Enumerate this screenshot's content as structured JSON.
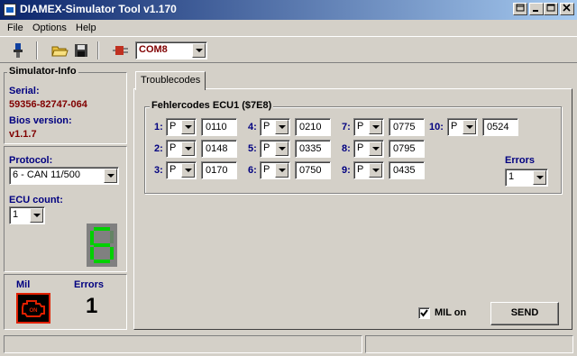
{
  "window": {
    "title": "DIAMEX-Simulator Tool v1.170"
  },
  "menu": {
    "file": "File",
    "options": "Options",
    "help": "Help"
  },
  "toolbar": {
    "port": "COM8"
  },
  "info": {
    "heading": "Simulator-Info",
    "serial_label": "Serial:",
    "serial_value": "59356-82747-064",
    "bios_label": "Bios version:",
    "bios_value": "v1.1.7"
  },
  "protocol": {
    "label": "Protocol:",
    "value": "6 - CAN 11/500"
  },
  "ecu": {
    "label": "ECU count:",
    "value": "1",
    "display_digit": "6"
  },
  "mil_panel": {
    "mil_label": "Mil",
    "errors_label": "Errors",
    "errors_count": "1",
    "icon_text": "ON"
  },
  "tab": {
    "label": "Troublecodes"
  },
  "group": {
    "title": "Fehlercodes ECU1 ($7E8)"
  },
  "codes": [
    {
      "num": "1:",
      "type": "P",
      "code": "0110"
    },
    {
      "num": "2:",
      "type": "P",
      "code": "0148"
    },
    {
      "num": "3:",
      "type": "P",
      "code": "0170"
    },
    {
      "num": "4:",
      "type": "P",
      "code": "0210"
    },
    {
      "num": "5:",
      "type": "P",
      "code": "0335"
    },
    {
      "num": "6:",
      "type": "P",
      "code": "0750"
    },
    {
      "num": "7:",
      "type": "P",
      "code": "0775"
    },
    {
      "num": "8:",
      "type": "P",
      "code": "0795"
    },
    {
      "num": "9:",
      "type": "P",
      "code": "0435"
    },
    {
      "num": "10:",
      "type": "P",
      "code": "0524"
    }
  ],
  "errors_select": {
    "label": "Errors",
    "value": "1"
  },
  "mil_checkbox": {
    "label": "MIL on",
    "checked": true
  },
  "send_button": {
    "label": "SEND"
  },
  "colors": {
    "accent_navy": "#000080",
    "value_maroon": "#800000",
    "led_green": "#00d000",
    "mil_red": "#e02000"
  }
}
